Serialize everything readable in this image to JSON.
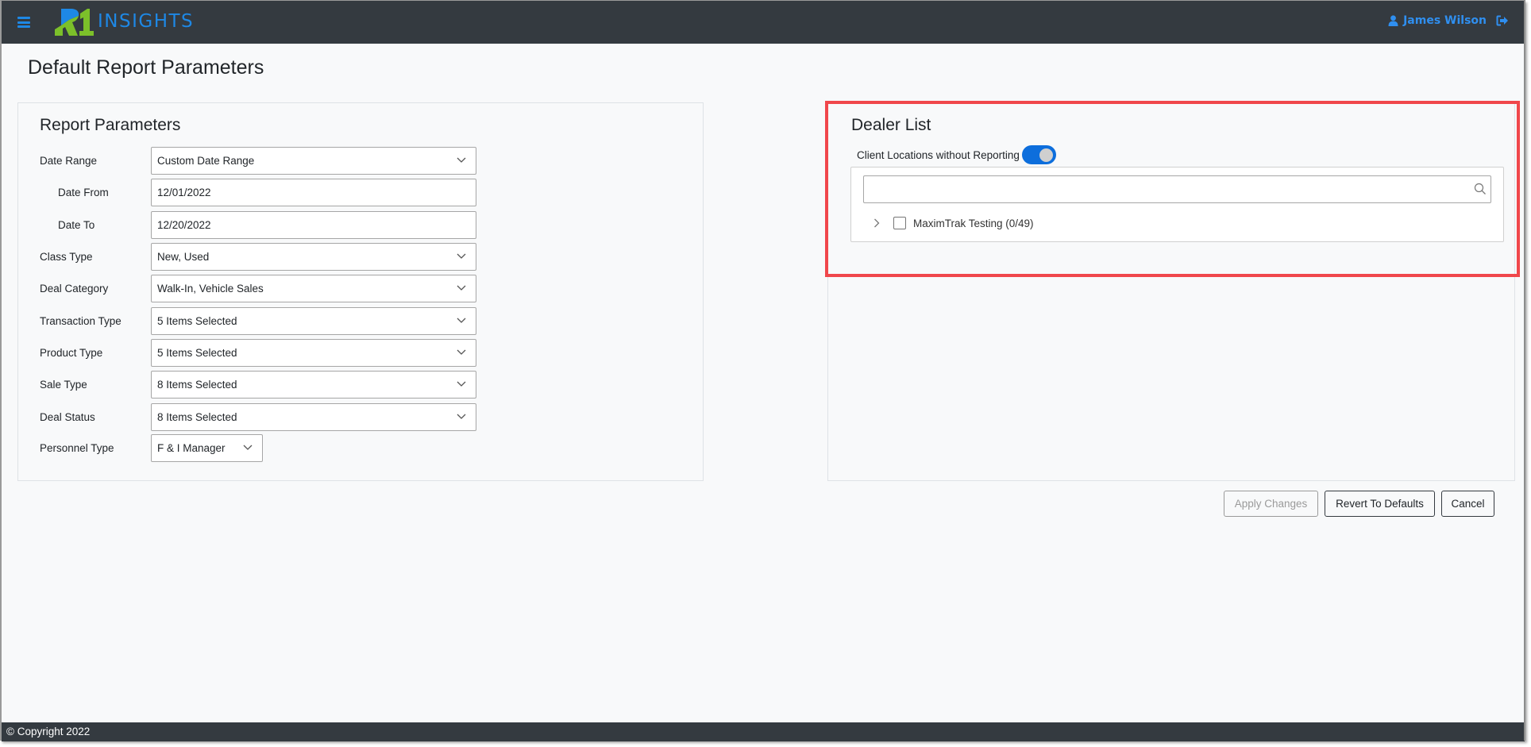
{
  "header": {
    "menu_icon": "hamburger-icon",
    "brand_logo": "R1",
    "brand_text": "INSIGHTS",
    "user_name": "James Wilson",
    "user_icon": "user-icon",
    "logout_icon": "sign-out-icon",
    "colors": {
      "bar": "#343a40",
      "accent": "#1e88e5",
      "logo_green": "#7cc02a"
    }
  },
  "page": {
    "title": "Default Report Parameters"
  },
  "report_parameters": {
    "title": "Report Parameters",
    "fields": [
      {
        "label": "Date Range",
        "value": "Custom Date Range",
        "type": "select"
      },
      {
        "label": "Date From",
        "value": "12/01/2022",
        "type": "input"
      },
      {
        "label": "Date To",
        "value": "12/20/2022",
        "type": "input"
      },
      {
        "label": "Class Type",
        "value": "New, Used",
        "type": "select"
      },
      {
        "label": "Deal Category",
        "value": "Walk-In, Vehicle Sales",
        "type": "select"
      },
      {
        "label": "Transaction Type",
        "value": "5 Items Selected",
        "type": "select"
      },
      {
        "label": "Product Type",
        "value": "5 Items Selected",
        "type": "select"
      },
      {
        "label": "Sale Type",
        "value": "8 Items Selected",
        "type": "select"
      },
      {
        "label": "Deal Status",
        "value": "8 Items Selected",
        "type": "select"
      },
      {
        "label": "Personnel Type",
        "value": "F & I Manager",
        "type": "select"
      }
    ]
  },
  "dealer_list": {
    "title": "Dealer List",
    "toggle_label": "Client Locations without Reporting",
    "toggle_on": true,
    "search_value": "",
    "search_placeholder": "",
    "items": [
      {
        "label": "MaximTrak Testing (0/49)",
        "checked": false,
        "expanded": false
      }
    ],
    "highlight_color": "#f0474b"
  },
  "actions": {
    "apply_label": "Apply Changes",
    "apply_disabled": true,
    "revert_label": "Revert To Defaults",
    "cancel_label": "Cancel"
  },
  "footer": {
    "copyright": "© Copyright 2022"
  }
}
